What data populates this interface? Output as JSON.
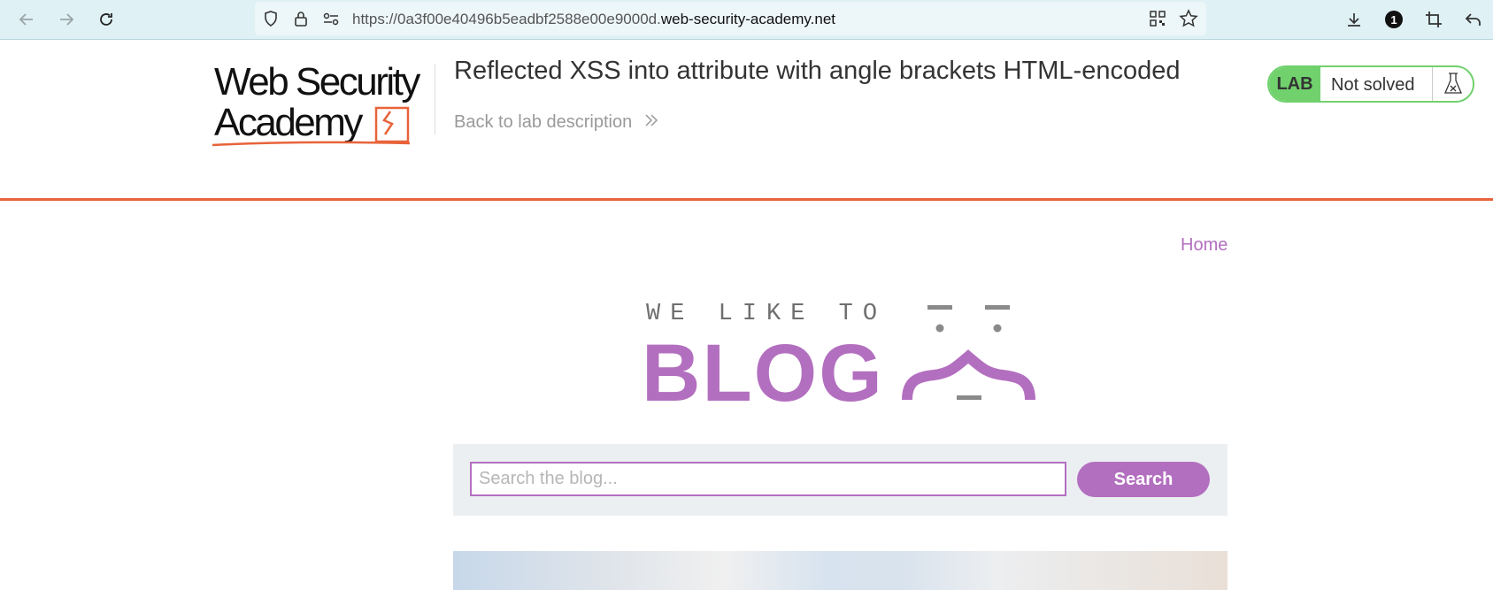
{
  "browser": {
    "url_prefix": "https://0a3f00e40496b5eadbf2588e00e9000d.",
    "url_domain": "web-security-academy.net",
    "notification_count": "1"
  },
  "header": {
    "logo_line1": "Web Security",
    "logo_line2": "Academy",
    "title": "Reflected XSS into attribute with angle brackets HTML-encoded",
    "back_link": "Back to lab description",
    "lab_badge": "LAB",
    "status": "Not solved"
  },
  "nav": {
    "home": "Home"
  },
  "blog_banner": {
    "tagline": "WE LIKE TO",
    "word": "BLOG"
  },
  "search": {
    "placeholder": "Search the blog...",
    "value": "",
    "button": "Search"
  },
  "colors": {
    "accent": "#b36fbf",
    "orange": "#e8633a",
    "lab_green": "#70d16d"
  }
}
